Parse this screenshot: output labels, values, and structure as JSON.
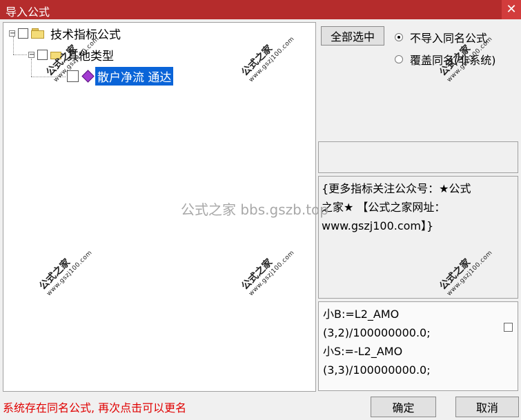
{
  "window": {
    "title": "导入公式",
    "close_glyph": "✕"
  },
  "tree": {
    "root": {
      "label": "技术指标公式",
      "expander": "−"
    },
    "child": {
      "label": "其他类型",
      "expander": "−"
    },
    "leaf": {
      "label": "散户净流 通达"
    }
  },
  "options": {
    "select_all_label": "全部选中",
    "radio_no_import": "不导入同名公式",
    "radio_overwrite": "覆盖同名(非系统)"
  },
  "description": "{更多指标关注公众号：★公式\n之家★ 【公式之家网址：\nwww.gszj100.com】}",
  "code": "小B:=L2_AMO\n(3,2)/100000000.0;\n小S:=-L2_AMO\n(3,3)/100000000.0;",
  "status_message": "系统存在同名公式, 再次点击可以更名",
  "buttons": {
    "ok_label": "确定",
    "cancel_label": "取消"
  },
  "watermarks": {
    "site_name": "公式之家",
    "site_url": "www.gszj100.com",
    "center": "公式之家 bbs.gszb.top"
  },
  "colors": {
    "titlebar": "#b52c2c",
    "selection": "#0a64d8",
    "status_text": "#e00000"
  }
}
